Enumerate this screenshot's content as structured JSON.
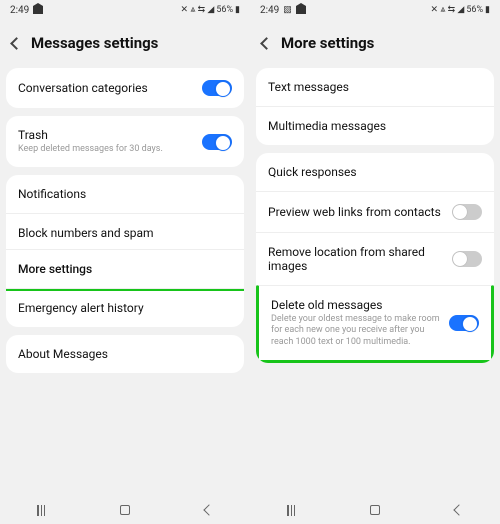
{
  "status": {
    "time": "2:49",
    "batteryText": "56%",
    "signalGlyphs": "✈ ⋮ ⇄ ⫴"
  },
  "left": {
    "title": "Messages settings",
    "conversationCategories": "Conversation categories",
    "trash": {
      "label": "Trash",
      "sub": "Keep deleted messages for 30 days."
    },
    "notifications": "Notifications",
    "blockSpam": "Block numbers and spam",
    "moreSettings": "More settings",
    "emergency": "Emergency alert history",
    "about": "About Messages"
  },
  "right": {
    "title": "More settings",
    "textMessages": "Text messages",
    "multimedia": "Multimedia messages",
    "quickResponses": "Quick responses",
    "previewLinks": "Preview web links from contacts",
    "removeLocation": "Remove location from shared images",
    "deleteOld": {
      "label": "Delete old messages",
      "sub": "Delete your oldest message to make room for each new one you receive after you reach 1000 text or 100 multimedia."
    }
  }
}
